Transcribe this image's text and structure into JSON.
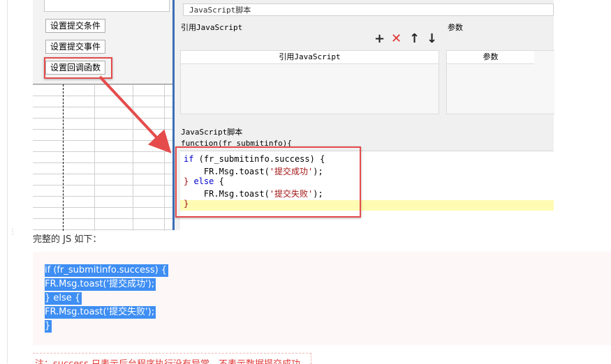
{
  "left_panel": {
    "buttons": [
      "设置提交条件",
      "设置提交事件",
      "设置回调函数"
    ]
  },
  "dialog": {
    "js_tab_label": "JavaScript脚本",
    "ref_js_label": "引用JavaScript",
    "params_label": "参数",
    "toolbar_icons": [
      "plus-icon",
      "delete-icon",
      "arrow-up-icon",
      "arrow-down-icon"
    ],
    "table_ref_header": "引用JavaScript",
    "table_params_header": "参数",
    "script_label": "JavaScript脚本",
    "function_sig": "function(fr_submitinfo){",
    "code_lines": [
      {
        "kw": "if",
        "rest": " (fr_submitinfo.success) {"
      },
      {
        "prefix": "    FR.Msg.toast(",
        "str": "'提交成功'",
        "suffix": ");"
      },
      {
        "brace": "}",
        "kw": " else",
        "rest": " {"
      },
      {
        "prefix": "    FR.Msg.toast(",
        "str": "'提交失败'",
        "suffix": ");"
      },
      {
        "brace": "}"
      }
    ]
  },
  "doc": {
    "intro": "完整的 JS 如下：",
    "code_lines": [
      "if (fr_submitinfo.success) {",
      "FR.Msg.toast('提交成功');",
      "} else {",
      "FR.Msg.toast('提交失败');",
      "}"
    ],
    "note": "注：success 只表示后台程序执行没有异常，不表示数据提交成功"
  },
  "colors": {
    "annotation_red": "#e54b4b",
    "selection_blue": "#3e8ef3",
    "note_red": "#e23b3b"
  }
}
